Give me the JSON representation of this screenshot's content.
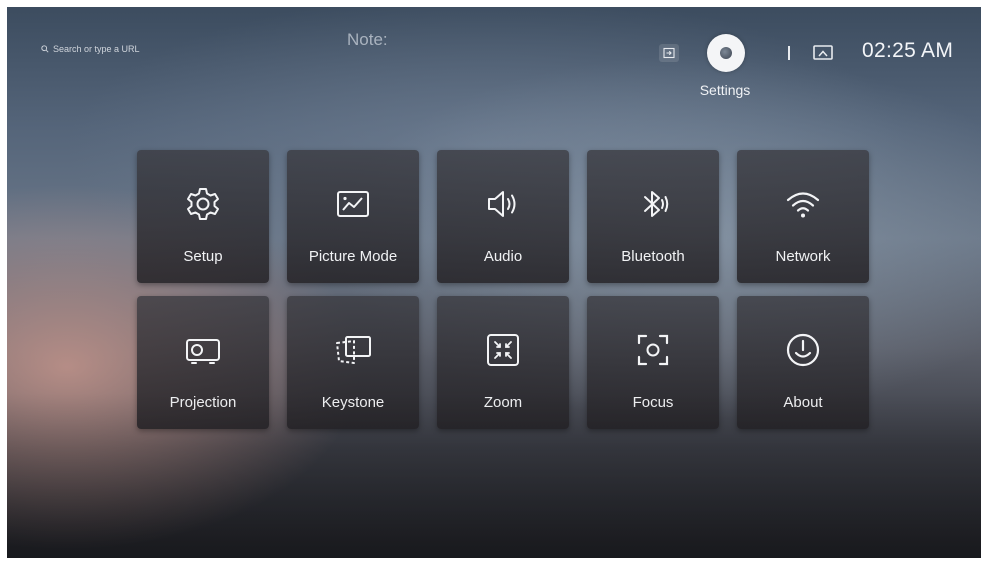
{
  "topbar": {
    "search_placeholder": "Search or type a URL",
    "note": "Note:",
    "settings_label": "Settings",
    "clock": "02:25 AM",
    "icons": {
      "search": "search-icon",
      "input_source": "input-source-icon",
      "settings": "settings-icon",
      "screen": "screen-icon"
    }
  },
  "tiles": [
    {
      "label": "Setup",
      "icon": "gear-icon"
    },
    {
      "label": "Picture Mode",
      "icon": "picture-mode-icon"
    },
    {
      "label": "Audio",
      "icon": "speaker-icon"
    },
    {
      "label": "Bluetooth",
      "icon": "bluetooth-icon"
    },
    {
      "label": "Network",
      "icon": "wifi-icon"
    },
    {
      "label": "Projection",
      "icon": "projector-icon"
    },
    {
      "label": "Keystone",
      "icon": "keystone-icon"
    },
    {
      "label": "Zoom",
      "icon": "zoom-icon"
    },
    {
      "label": "Focus",
      "icon": "focus-icon"
    },
    {
      "label": "About",
      "icon": "about-icon"
    }
  ]
}
